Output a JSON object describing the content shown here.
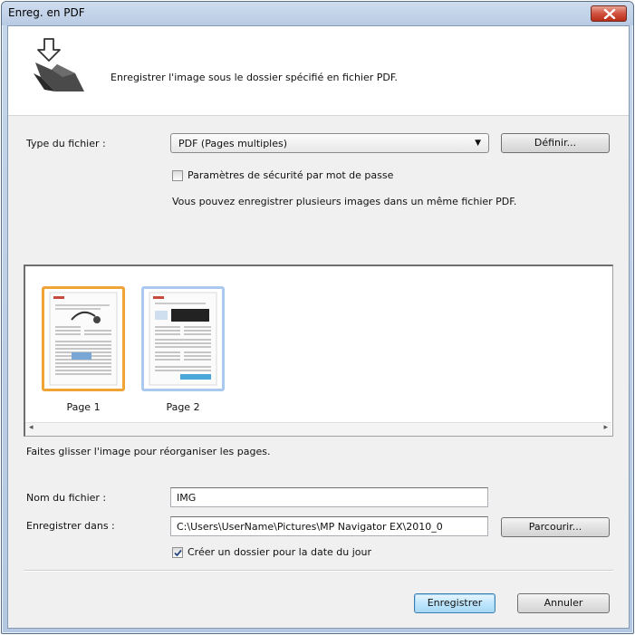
{
  "window": {
    "title": "Enreg. en PDF"
  },
  "header": {
    "description": "Enregistrer l'image sous le dossier spécifié en fichier PDF."
  },
  "file_type": {
    "label": "Type du fichier :",
    "selected": "PDF (Pages multiples)",
    "define_button": "Définir..."
  },
  "password_security": {
    "label": "Paramètres de sécurité par mot de passe",
    "checked": false
  },
  "info_text": "Vous pouvez enregistrer plusieurs images dans un même fichier PDF.",
  "pages": [
    {
      "caption": "Page 1",
      "selected": true
    },
    {
      "caption": "Page 2",
      "selected": false
    }
  ],
  "drag_hint": "Faites glisser l'image pour réorganiser les pages.",
  "file_name": {
    "label": "Nom du fichier :",
    "value": "IMG"
  },
  "save_in": {
    "label": "Enregistrer dans :",
    "value": "C:\\Users\\UserName\\Pictures\\MP Navigator EX\\2010_0",
    "browse_button": "Parcourir..."
  },
  "date_folder": {
    "label": "Créer un dossier pour la date du jour",
    "checked": true
  },
  "footer": {
    "save_button": "Enregistrer",
    "cancel_button": "Annuler"
  },
  "colors": {
    "title_bar": "#b8cbe4",
    "selected_thumb": "#f0a436",
    "unselected_thumb": "#a9c9ee",
    "close_button": "#d05340"
  },
  "icons": {
    "close": "close-x-icon",
    "header": "save-folder-arrow-icon",
    "dropdown": "chevron-down-icon"
  }
}
